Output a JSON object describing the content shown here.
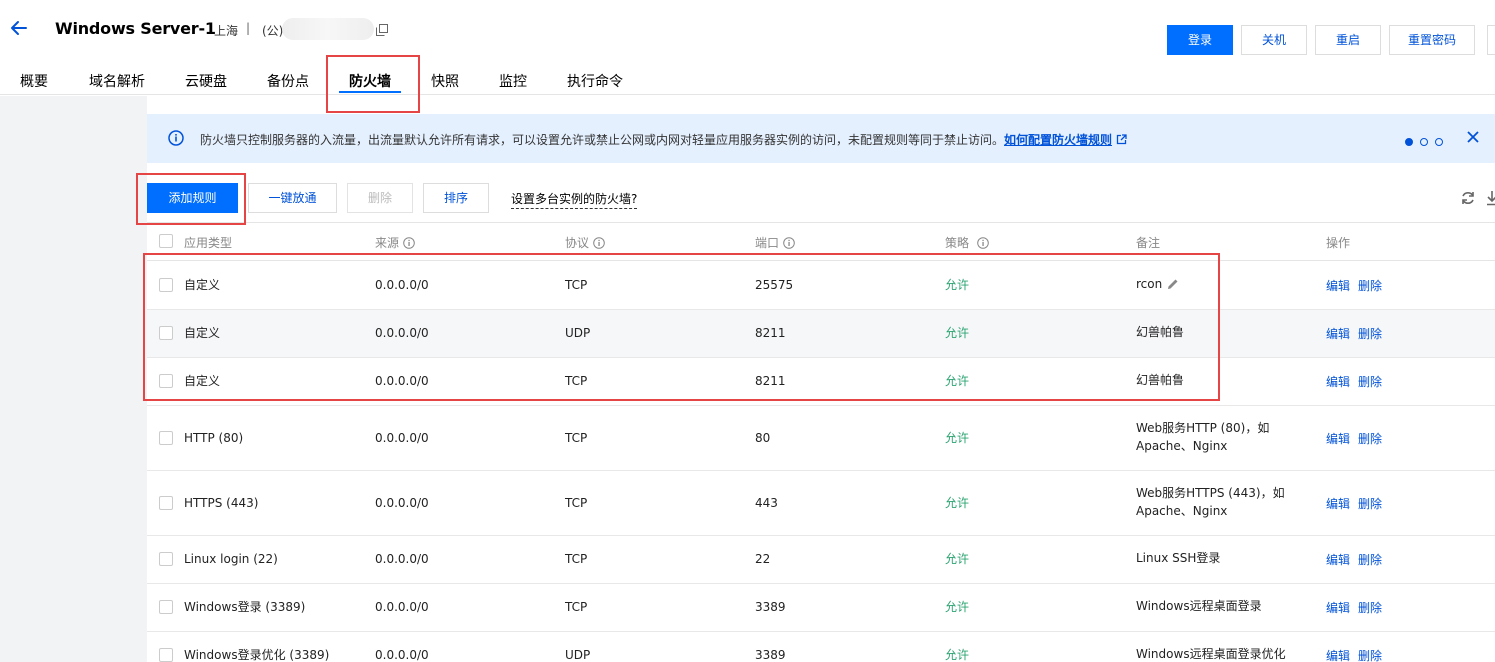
{
  "header": {
    "title": "Windows Server-1",
    "region": "上海",
    "separator": "|",
    "ip_label": "(公)"
  },
  "top_buttons": [
    "登录",
    "关机",
    "重启",
    "重置密码"
  ],
  "tabs": [
    "概要",
    "域名解析",
    "云硬盘",
    "备份点",
    "防火墙",
    "快照",
    "监控",
    "执行命令"
  ],
  "notice": {
    "text": "防火墙只控制服务器的入流量，出流量默认允许所有请求，可以设置允许或禁止公网或内网对轻量应用服务器实例的访问，未配置规则等同于禁止访问。",
    "link": "如何配置防火墙规则"
  },
  "toolbar": {
    "add": "添加规则",
    "one_click": "一键放通",
    "delete": "删除",
    "sort": "排序",
    "multi_instance": "设置多台实例的防火墙?"
  },
  "table": {
    "headers": [
      "应用类型",
      "来源",
      "协议",
      "端口",
      "策略",
      "备注",
      "操作"
    ],
    "action_edit": "编辑",
    "action_delete": "删除",
    "rows": [
      {
        "type": "自定义",
        "source": "0.0.0.0/0",
        "protocol": "TCP",
        "port": "25575",
        "policy": "允许",
        "note1": "rcon",
        "note2": ""
      },
      {
        "type": "自定义",
        "source": "0.0.0.0/0",
        "protocol": "UDP",
        "port": "8211",
        "policy": "允许",
        "note1": "幻兽帕鲁",
        "note2": ""
      },
      {
        "type": "自定义",
        "source": "0.0.0.0/0",
        "protocol": "TCP",
        "port": "8211",
        "policy": "允许",
        "note1": "幻兽帕鲁",
        "note2": ""
      },
      {
        "type": "HTTP (80)",
        "source": "0.0.0.0/0",
        "protocol": "TCP",
        "port": "80",
        "policy": "允许",
        "note1": "Web服务HTTP (80)，如",
        "note2": "Apache、Nginx"
      },
      {
        "type": "HTTPS (443)",
        "source": "0.0.0.0/0",
        "protocol": "TCP",
        "port": "443",
        "policy": "允许",
        "note1": "Web服务HTTPS (443)，如",
        "note2": "Apache、Nginx"
      },
      {
        "type": "Linux login (22)",
        "source": "0.0.0.0/0",
        "protocol": "TCP",
        "port": "22",
        "policy": "允许",
        "note1": "Linux SSH登录",
        "note2": ""
      },
      {
        "type": "Windows登录 (3389)",
        "source": "0.0.0.0/0",
        "protocol": "TCP",
        "port": "3389",
        "policy": "允许",
        "note1": "Windows远程桌面登录",
        "note2": ""
      },
      {
        "type": "Windows登录优化 (3389)",
        "source": "0.0.0.0/0",
        "protocol": "UDP",
        "port": "3389",
        "policy": "允许",
        "note1": "Windows远程桌面登录优化",
        "note2": ""
      }
    ]
  },
  "colors": {
    "primary": "#006eff",
    "link": "#0052d9",
    "allow": "#2ba471",
    "highlight": "#e54545",
    "notice_bg": "#e5f0ff"
  }
}
